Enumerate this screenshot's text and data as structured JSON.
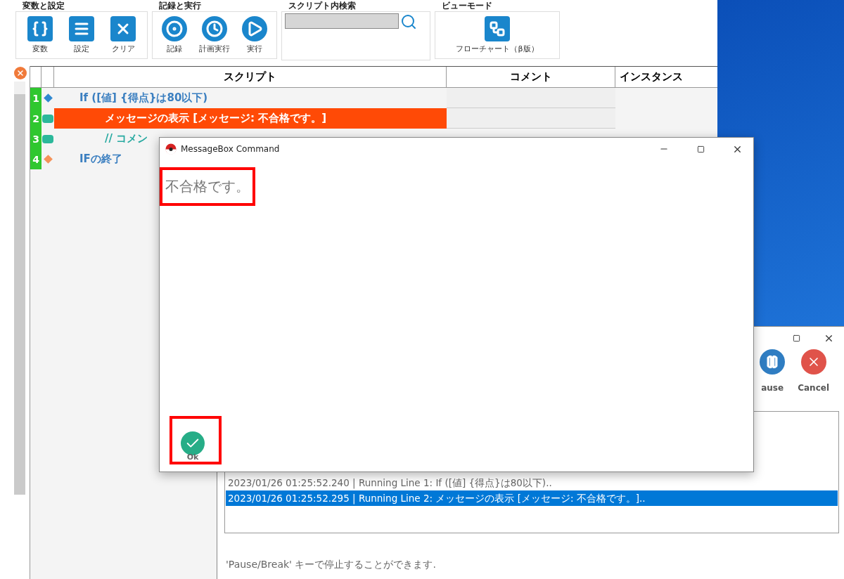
{
  "ribbon": {
    "groups": [
      {
        "title": "変数と設定",
        "kind": "buttons",
        "buttons": [
          {
            "label": "変数"
          },
          {
            "label": "設定"
          },
          {
            "label": "クリア"
          }
        ]
      },
      {
        "title": "記録と実行",
        "kind": "buttons",
        "buttons": [
          {
            "label": "記録"
          },
          {
            "label": "計画実行"
          },
          {
            "label": "実行"
          }
        ]
      },
      {
        "title": "スクリプト内検索",
        "kind": "search"
      },
      {
        "title": "ビューモード",
        "kind": "buttons",
        "buttons": [
          {
            "label": "フローチャート（β版）"
          }
        ]
      }
    ]
  },
  "script_grid": {
    "columns": [
      "スクリプト",
      "コメント",
      "インスタンス"
    ],
    "rows": [
      {
        "number": "1",
        "kind": "if",
        "text": "If ([値] {得点}は80以下)",
        "selected": false,
        "children": [
          {
            "number": "2",
            "kind": "message",
            "text": "メッセージの表示 [メッセージ: 不合格です。]",
            "selected": true
          },
          {
            "number": "3",
            "kind": "comment",
            "text": "// コメン",
            "selected": false
          }
        ]
      },
      {
        "number": "4",
        "kind": "endif",
        "text": "IFの終了",
        "selected": false
      }
    ]
  },
  "message_box": {
    "title": "MessageBox Command",
    "message": "不合格です。",
    "ok_label": "Ok"
  },
  "progress_window": {
    "buttons": [
      {
        "kind": "pause",
        "label": "ause"
      },
      {
        "kind": "cancel",
        "label": "Cancel"
      }
    ],
    "log": [
      {
        "text": "2023/01/26 01:25:52.240 | Running Line 1: If ([値] {得点}は80以下)..",
        "selected": false
      },
      {
        "text": "2023/01/26 01:25:52.295 | Running Line 2: メッセージの表示 [メッセージ: 不合格です。]..",
        "selected": true
      }
    ],
    "hint": "'Pause/Break' キーで停止することができます."
  }
}
